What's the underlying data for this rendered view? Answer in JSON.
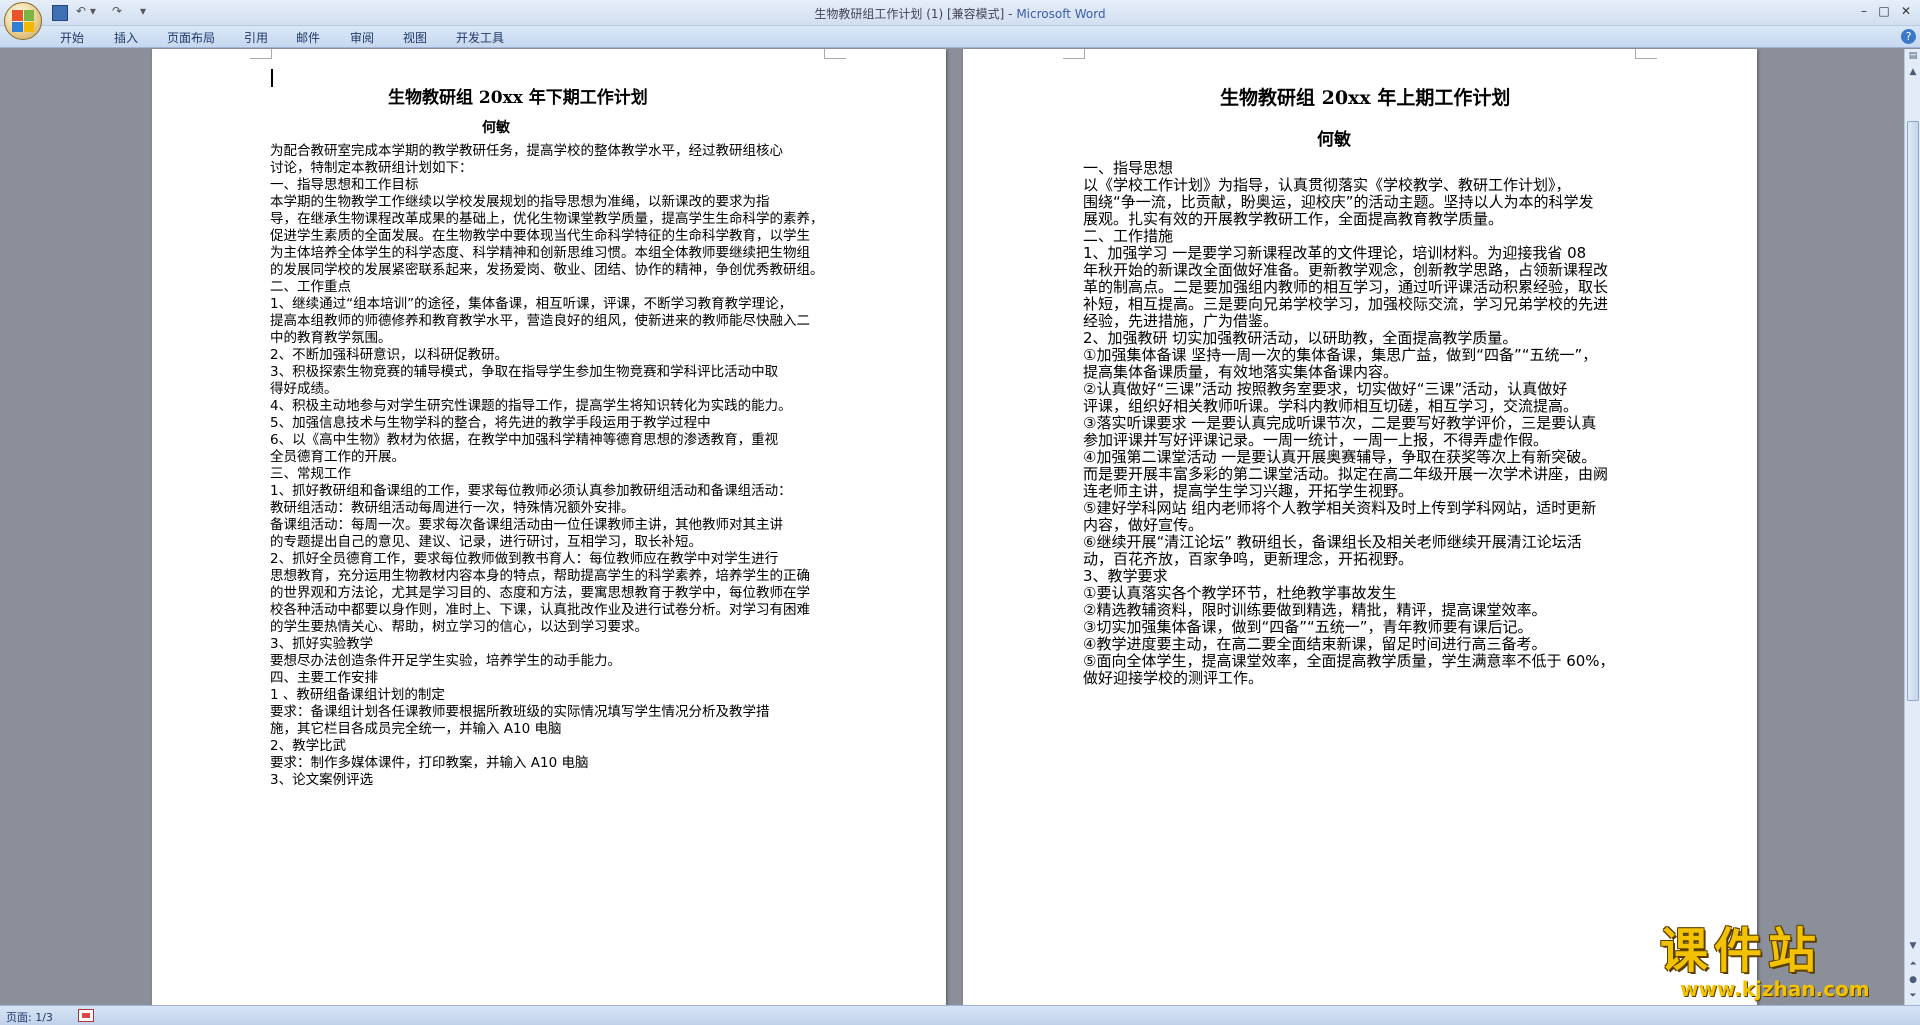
{
  "window": {
    "title": "生物教研组工作计划 (1) [兼容模式] - ",
    "app": "Microsoft Word"
  },
  "ribbon": {
    "tabs": [
      "开始",
      "插入",
      "页面布局",
      "引用",
      "邮件",
      "审阅",
      "视图",
      "开发工具"
    ]
  },
  "status": {
    "page": "页面: 1/3"
  },
  "watermark": {
    "text": "课件站",
    "url": "www.kjzhan.com"
  },
  "doc_left": {
    "title": "生物教研组 20xx 年下期工作计划",
    "author": "何敏",
    "lines": [
      "   为配合教研室完成本学期的教学教研任务，提高学校的整体教学水平，经过教研组核心",
      "讨论，特制定本教研组计划如下：",
      "一、指导思想和工作目标",
      "   本学期的生物教学工作继续以学校发展规划的指导思想为准绳，以新课改的要求为指",
      "导，在继承生物课程改革成果的基础上，优化生物课堂教学质量，提高学生生命科学的素养，",
      "促进学生素质的全面发展。在生物教学中要体现当代生命科学特征的生命科学教育，以学生",
      "为主体培养全体学生的科学态度、科学精神和创新思维习惯。本组全体教师要继续把生物组",
      "的发展同学校的发展紧密联系起来，发扬爱岗、敬业、团结、协作的精神，争创优秀教研组。",
      "二、工作重点",
      "   1、继续通过“组本培训”的途径，集体备课，相互听课，评课，不断学习教育教学理论，",
      "提高本组教师的师德修养和教育教学水平，营造良好的组风，使新进来的教师能尽快融入二",
      "中的教育教学氛围。",
      "   2、不断加强科研意识，以科研促教研。",
      "   3、积极探索生物竞赛的辅导模式，争取在指导学生参加生物竞赛和学科评比活动中取",
      "得好成绩。",
      "   4、积极主动地参与对学生研究性课题的指导工作，提高学生将知识转化为实践的能力。",
      "   5、加强信息技术与生物学科的整合，将先进的教学手段运用于教学过程中",
      "   6、以《高中生物》教材为依据，在教学中加强科学精神等德育思想的渗透教育，重视",
      "全员德育工作的开展。",
      "三、常规工作",
      "   1、抓好教研组和备课组的工作，要求每位教师必须认真参加教研组活动和备课组活动：",
      "   教研组活动：教研组活动每周进行一次，特殊情况额外安排。",
      "   备课组活动：每周一次。要求每次备课组活动由一位任课教师主讲，其他教师对其主讲",
      "的专题提出自己的意见、建议、记录，进行研讨，互相学习，取长补短。",
      "   2、抓好全员德育工作，要求每位教师做到教书育人：每位教师应在教学中对学生进行",
      "思想教育，充分运用生物教材内容本身的特点，帮助提高学生的科学素养，培养学生的正确",
      "的世界观和方法论，尤其是学习目的、态度和方法，要寓思想教育于教学中，每位教师在学",
      "校各种活动中都要以身作则，准时上、下课，认真批改作业及进行试卷分析。对学习有困难",
      "的学生要热情关心、帮助，树立学习的信心，以达到学习要求。",
      "   3、抓好实验教学",
      " 要想尽办法创造条件开足学生实验，培养学生的动手能力。",
      "四、主要工作安排",
      "  1 、教研组备课组计划的制定",
      "   要求：备课组计划各任课教师要根据所教班级的实际情况填写学生情况分析及教学措",
      "施，其它栏目各成员完全统一，并输入 A10 电脑",
      "  2、教学比武",
      "要求：制作多媒体课件，打印教案，并输入 A10 电脑",
      "  3、论文案例评选"
    ]
  },
  "doc_right": {
    "title": "生物教研组 20xx 年上期工作计划",
    "author": "何敏",
    "lines": [
      "一、指导思想",
      "    以《学校工作计划》为指导，认真贯彻落实《学校教学、教研工作计划》，",
      "围绕“争一流，比贡献，盼奥运，迎校庆”的活动主题。坚持以人为本的科学发",
      "展观。扎实有效的开展教学教研工作，全面提高教育教学质量。",
      "二、工作措施",
      "  1、加强学习  一是要学习新课程改革的文件理论，培训材料。为迎接我省 08",
      "年秋开始的新课改全面做好准备。更新教学观念，创新教学思路，占领新课程改",
      "革的制高点。二是要加强组内教师的相互学习，通过听评课活动积累经验，取长",
      "补短，相互提高。三是要向兄弟学校学习，加强校际交流，学习兄弟学校的先进",
      "经验，先进措施，广为借鉴。",
      "  2、加强教研  切实加强教研活动，以研助教，全面提高教学质量。",
      "①加强集体备课  坚持一周一次的集体备课，集思广益，做到“四备”“五统一”，",
      "提高集体备课质量，有效地落实集体备课内容。",
      "②认真做好“三课”活动 按照教务室要求，切实做好“三课”活动，认真做好",
      "评课，组织好相关教师听课。学科内教师相互切磋，相互学习，交流提高。",
      "③落实听课要求 一是要认真完成听课节次，二是要写好教学评价，三是要认真",
      "参加评课并写好评课记录。一周一统计，一周一上报，不得弄虚作假。",
      "④加强第二课堂活动 一是要认真开展奥赛辅导，争取在获奖等次上有新突破。",
      "而是要开展丰富多彩的第二课堂活动。拟定在高二年级开展一次学术讲座，由阙",
      "连老师主讲，提高学生学习兴趣，开拓学生视野。",
      "⑤建好学科网站 组内老师将个人教学相关资料及时上传到学科网站，适时更新",
      "内容，做好宣传。",
      "⑥继续开展“清江论坛” 教研组长，备课组长及相关老师继续开展清江论坛活",
      "动，百花齐放，百家争鸣，更新理念，开拓视野。",
      "  3、教学要求",
      "①要认真落实各个教学环节，杜绝教学事故发生",
      "②精选教辅资料，限时训练要做到精选，精批，精评，提高课堂效率。",
      "③切实加强集体备课，做到“四备”“五统一”，青年教师要有课后记。",
      "④教学进度要主动，在高二要全面结束新课，留足时间进行高三备考。",
      "⑤面向全体学生，提高课堂效率，全面提高教学质量，学生满意率不低于 60%，",
      "做好迎接学校的测评工作。"
    ]
  }
}
